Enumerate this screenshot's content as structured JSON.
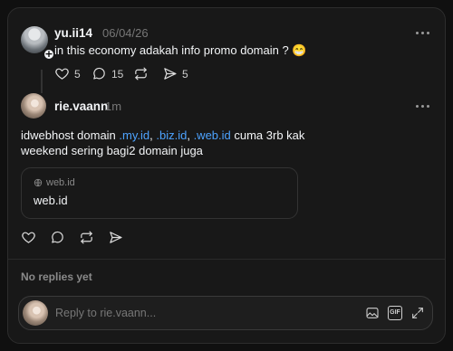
{
  "original_post": {
    "username": "yu.ii14",
    "timestamp": "06/04/26",
    "text": "in this economy adakah info promo domain ?",
    "emoji": "😁",
    "stats": {
      "likes": "5",
      "replies": "15",
      "shares": "5"
    }
  },
  "reply_post": {
    "username": "rie.vaann",
    "timestamp": "1m",
    "text_part1": "idwebhost domain ",
    "link1": ".my.id",
    "text_sep1": ", ",
    "link2": ".biz.id",
    "text_sep2": ", ",
    "link3": ".web.id",
    "text_part2": " cuma 3rb kak",
    "text_line2": "weekend sering bagi2 domain juga",
    "link_card": {
      "domain": "web.id",
      "title": "web.id"
    }
  },
  "no_replies_label": "No replies yet",
  "reply_box": {
    "placeholder": "Reply to rie.vaann...",
    "gif_label": "GIF"
  },
  "icons": {
    "like": "heart-icon",
    "comment": "comment-icon",
    "repost": "repost-icon",
    "share": "send-icon",
    "more": "more-dots-icon",
    "globe": "globe-icon",
    "image": "image-icon",
    "gif": "gif-icon",
    "expand": "expand-icon"
  }
}
